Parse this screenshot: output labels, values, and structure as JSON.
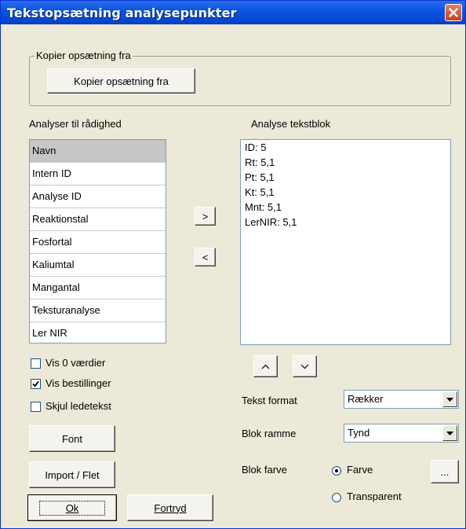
{
  "window": {
    "title": "Tekstopsætning analysepunkter"
  },
  "copy_group": {
    "legend": "Kopier opsætning fra",
    "button_label": "Kopier opsætning fra"
  },
  "available": {
    "label": "Analyser til rådighed",
    "items": [
      "Navn",
      "Intern ID",
      "Analyse ID",
      "Reaktionstal",
      "Fosfortal",
      "Kaliumtal",
      "Mangantal",
      "Teksturanalyse",
      "Ler NIR"
    ],
    "selected_index": 0
  },
  "move_buttons": {
    "add": ">",
    "remove": "<"
  },
  "textblock": {
    "label": "Analyse tekstblok",
    "lines": [
      "ID: 5",
      "Rt: 5,1",
      "Pt: 5,1",
      "Kt: 5,1",
      "Mnt: 5,1",
      "LerNIR: 5,1"
    ]
  },
  "order_buttons": {
    "up": "^",
    "down": "v"
  },
  "options": {
    "show_zero": {
      "label": "Vis 0 værdier",
      "checked": false
    },
    "show_orders": {
      "label": "Vis bestillinger",
      "checked": true
    },
    "hide_lead": {
      "label": "Skjul ledetekst",
      "checked": false
    }
  },
  "format": {
    "text_format": {
      "label": "Tekst format",
      "value": "Rækker"
    },
    "block_frame": {
      "label": "Blok ramme",
      "value": "Tynd"
    },
    "block_color": {
      "label": "Blok farve",
      "options": [
        "Farve",
        "Transparent"
      ],
      "selected": "Farve",
      "picker_label": "..."
    }
  },
  "buttons": {
    "font": "Font",
    "import": "Import / Flet",
    "ok": "Ok",
    "cancel": "Fortryd"
  },
  "colors": {
    "titlebar": "#0a55e0",
    "dialog_bg": "#ece9d8",
    "close": "#c7401d"
  }
}
